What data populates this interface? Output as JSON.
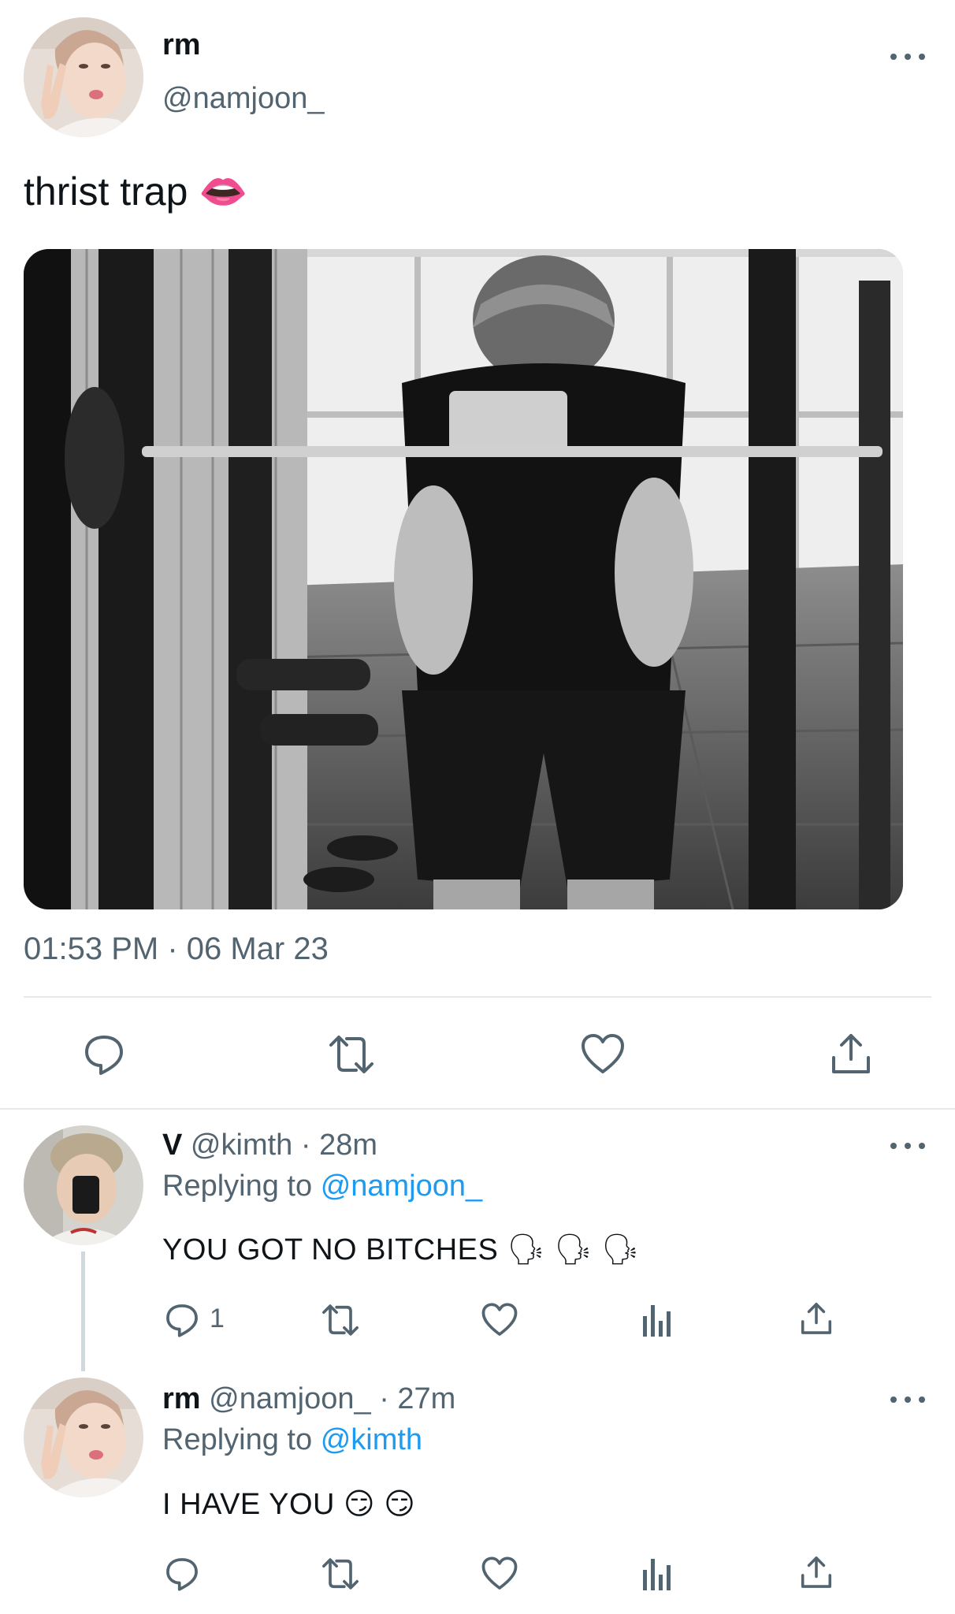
{
  "main_tweet": {
    "author_name": "rm",
    "author_handle": "@namjoon_",
    "text": "thrist trap 👄",
    "timestamp": "01:53 PM · 06 Mar 23"
  },
  "reply1": {
    "name": "V",
    "handle": "@kimth",
    "time": "· 28m",
    "replying_prefix": "Replying to",
    "replying_handle": "@namjoon_",
    "text": "YOU GOT NO BITCHES 🗣 🗣 🗣",
    "reply_count": "1"
  },
  "reply2": {
    "name": "rm",
    "handle": "@namjoon_",
    "time": "· 27m",
    "replying_prefix": "Replying to",
    "replying_handle": "@kimth",
    "text": "I HAVE YOU 😏 😏"
  },
  "icons": {
    "reply": "speech-bubble-icon",
    "retweet": "retweet-icon",
    "like": "heart-icon",
    "share": "share-upload-icon",
    "analytics": "bar-chart-icon",
    "more": "more-dots-icon"
  },
  "colors": {
    "text": "#0f1419",
    "muted": "#536471",
    "link": "#1d9bf0",
    "divider": "#e6e9eb"
  }
}
